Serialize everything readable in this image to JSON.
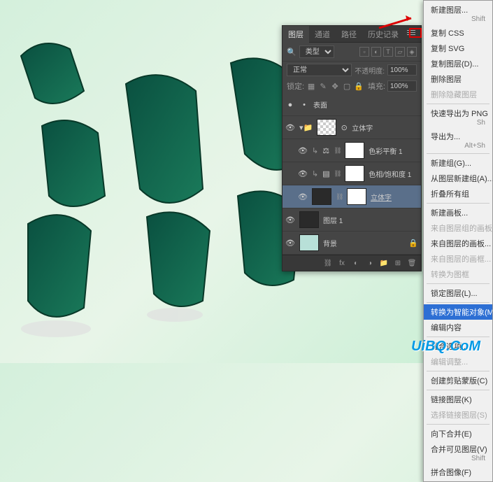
{
  "panel": {
    "tabs": [
      "图层",
      "通道",
      "路径",
      "历史记录"
    ],
    "filter_label": "类型",
    "blend_mode": "正常",
    "opacity_label": "不透明度:",
    "opacity_value": "100%",
    "lock_label": "锁定:",
    "fill_label": "填充:",
    "fill_value": "100%"
  },
  "layers": [
    {
      "name": "表面",
      "type": "surface"
    },
    {
      "name": "立体字",
      "type": "group"
    },
    {
      "name": "色彩平衡 1",
      "type": "adj"
    },
    {
      "name": "色相/饱和度 1",
      "type": "adj"
    },
    {
      "name": "立体字",
      "type": "smart",
      "selected": true
    },
    {
      "name": "图层 1",
      "type": "normal"
    },
    {
      "name": "背景",
      "type": "bg"
    }
  ],
  "menu": {
    "items": [
      {
        "label": "新建图层...",
        "shortcut": "Shift"
      },
      {
        "label": "复制 CSS"
      },
      {
        "label": "复制 SVG"
      },
      {
        "label": "复制图层(D)..."
      },
      {
        "label": "删除图层"
      },
      {
        "label": "删除隐藏图层",
        "disabled": true
      },
      {
        "sep": true
      },
      {
        "label": "快速导出为 PNG",
        "shortcut": "Sh"
      },
      {
        "label": "导出为...",
        "shortcut": "Alt+Sh"
      },
      {
        "sep": true
      },
      {
        "label": "新建组(G)..."
      },
      {
        "label": "从图层新建组(A)..."
      },
      {
        "label": "折叠所有组"
      },
      {
        "sep": true
      },
      {
        "label": "新建画板..."
      },
      {
        "label": "来自图层组的画板...",
        "disabled": true
      },
      {
        "label": "来自图层的画板..."
      },
      {
        "label": "来自图层的画框...",
        "disabled": true
      },
      {
        "label": "转换为图框",
        "disabled": true
      },
      {
        "sep": true
      },
      {
        "label": "锁定图层(L)..."
      },
      {
        "sep": true
      },
      {
        "label": "转换为智能对象(M)",
        "highlighted": true
      },
      {
        "label": "编辑内容"
      },
      {
        "sep": true
      },
      {
        "label": "混合选项..."
      },
      {
        "label": "编辑调整...",
        "disabled": true
      },
      {
        "sep": true
      },
      {
        "label": "创建剪贴蒙版(C)"
      },
      {
        "sep": true
      },
      {
        "label": "链接图层(K)"
      },
      {
        "label": "选择链接图层(S)",
        "disabled": true
      },
      {
        "sep": true
      },
      {
        "label": "向下合并(E)"
      },
      {
        "label": "合并可见图层(V)",
        "shortcut": "Shift"
      },
      {
        "label": "拼合图像(F)"
      }
    ]
  },
  "watermark": "UiBQ.CoM"
}
